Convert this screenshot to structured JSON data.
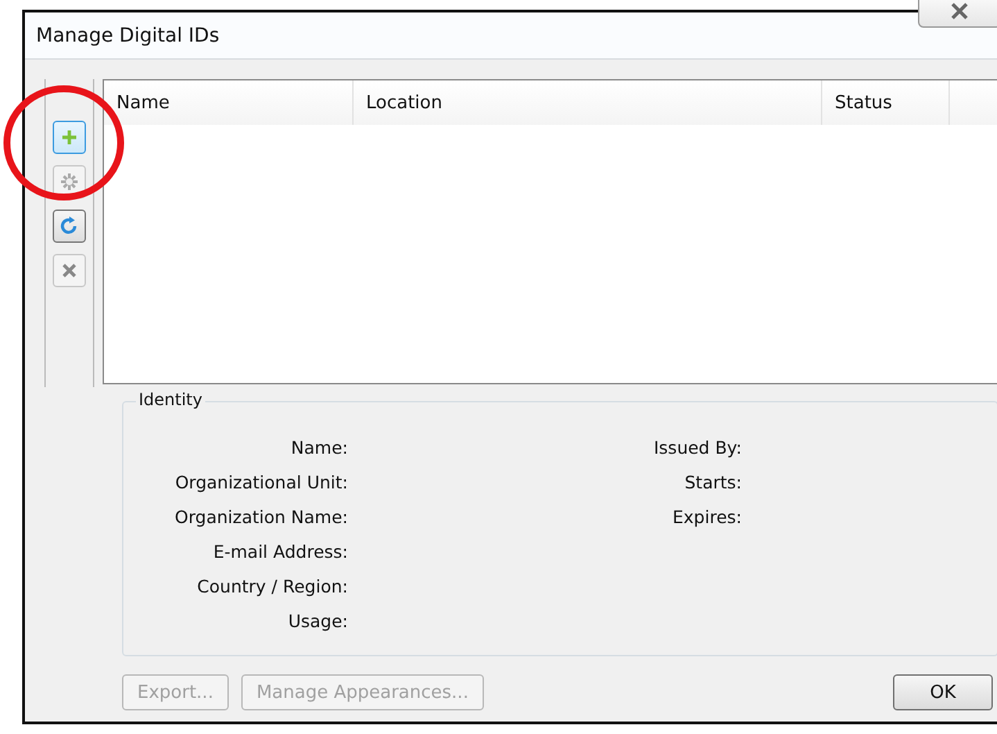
{
  "window": {
    "title": "Manage Digital IDs"
  },
  "toolbar": [
    {
      "kind": "add",
      "disabled": false,
      "selected": true
    },
    {
      "kind": "settings",
      "disabled": true,
      "selected": false
    },
    {
      "kind": "refresh",
      "disabled": false,
      "selected": false
    },
    {
      "kind": "delete",
      "disabled": true,
      "selected": false
    }
  ],
  "table": {
    "columns": [
      "Name",
      "Location",
      "Status"
    ]
  },
  "identity": {
    "title": "Identity",
    "left": [
      "Name:",
      "Organizational Unit:",
      "Organization Name:",
      "E-mail Address:",
      "Country / Region:",
      "Usage:"
    ],
    "right": [
      "Issued By:",
      "Starts:",
      "Expires:"
    ]
  },
  "buttons": [
    {
      "label": "Export...",
      "disabled": true
    },
    {
      "label": "Manage Appearances...",
      "disabled": true
    },
    {
      "label": "OK",
      "disabled": false
    }
  ]
}
